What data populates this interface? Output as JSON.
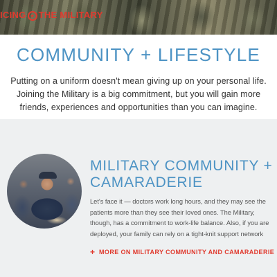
{
  "header": {
    "brand_text_left": "ICING",
    "brand_text_right": "THE MILITARY",
    "brand_icon": "star-circle-icon",
    "accent_color": "#e03a2e"
  },
  "intro": {
    "title": "COMMUNITY + LIFESTYLE",
    "body_lines": [
      "Putting on a uniform doesn't mean giving up on your personal life.",
      "Joining the Military is a big commitment, but you will gain more",
      "friends, experiences and opportunities than you can imagine."
    ],
    "title_color": "#4d93c4"
  },
  "community": {
    "title_lines": [
      "MILITARY COMMUNITY +",
      "CAMARADERIE"
    ],
    "body_lines": [
      "Let's face it — doctors work long hours, and they may see the",
      "patients more than they see their loved ones. The Military,",
      "though, has a commitment to work-life balance. Also, if you are",
      "deployed, your family can rely on a tight-knit support network"
    ],
    "link_icon": "plus-icon",
    "link_text": "MORE ON MILITARY COMMUNITY AND CAMARADERIE",
    "background_color": "#eef0f1"
  }
}
